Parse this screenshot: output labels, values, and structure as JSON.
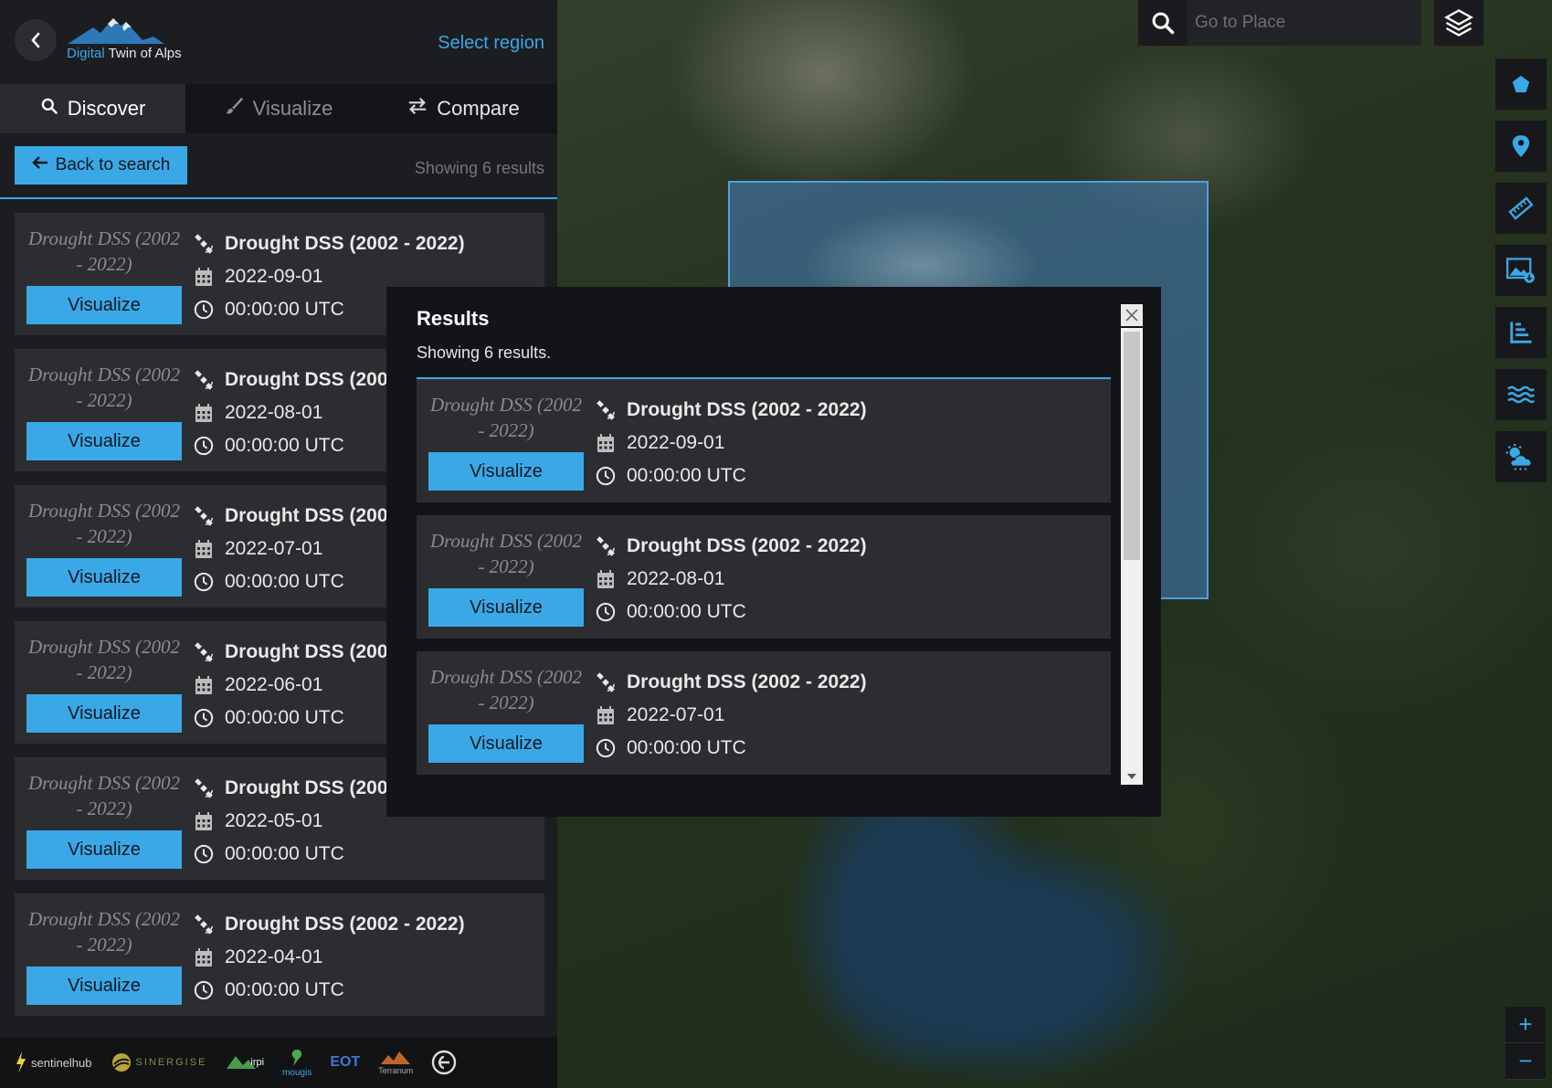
{
  "app": {
    "brand_accent": "Digital",
    "brand_rest": " Twin of Alps",
    "select_region": "Select region"
  },
  "tabs": [
    {
      "label": "Discover",
      "icon": "search-icon"
    },
    {
      "label": "Visualize",
      "icon": "brush-icon"
    },
    {
      "label": "Compare",
      "icon": "swap-icon"
    }
  ],
  "search": {
    "back_label": "Back to search",
    "showing": "Showing 6 results",
    "place_placeholder": "Go to Place"
  },
  "results": [
    {
      "thumb": "Drought DSS (2002 - 2022)",
      "name": "Drought DSS (2002 - 2022)",
      "date": "2022-09-01",
      "time": "00:00:00 UTC",
      "button": "Visualize"
    },
    {
      "thumb": "Drought DSS (2002 - 2022)",
      "name": "Drought DSS (200",
      "date": "2022-08-01",
      "time": "00:00:00 UTC",
      "button": "Visualize"
    },
    {
      "thumb": "Drought DSS (2002 - 2022)",
      "name": "Drought DSS (200",
      "date": "2022-07-01",
      "time": "00:00:00 UTC",
      "button": "Visualize"
    },
    {
      "thumb": "Drought DSS (2002 - 2022)",
      "name": "Drought DSS (200",
      "date": "2022-06-01",
      "time": "00:00:00 UTC",
      "button": "Visualize"
    },
    {
      "thumb": "Drought DSS (2002 - 2022)",
      "name": "Drought DSS (200",
      "date": "2022-05-01",
      "time": "00:00:00 UTC",
      "button": "Visualize"
    },
    {
      "thumb": "Drought DSS (2002 - 2022)",
      "name": "Drought DSS (2002 - 2022)",
      "date": "2022-04-01",
      "time": "00:00:00 UTC",
      "button": "Visualize"
    }
  ],
  "modal": {
    "title": "Results",
    "subtitle": "Showing 6 results.",
    "items": [
      {
        "thumb": "Drought DSS (2002 - 2022)",
        "name": "Drought DSS (2002 - 2022)",
        "date": "2022-09-01",
        "time": "00:00:00 UTC",
        "button": "Visualize"
      },
      {
        "thumb": "Drought DSS (2002 - 2022)",
        "name": "Drought DSS (2002 - 2022)",
        "date": "2022-08-01",
        "time": "00:00:00 UTC",
        "button": "Visualize"
      },
      {
        "thumb": "Drought DSS (2002 - 2022)",
        "name": "Drought DSS (2002 - 2022)",
        "date": "2022-07-01",
        "time": "00:00:00 UTC",
        "button": "Visualize"
      }
    ]
  },
  "toolbar": [
    "pentagon-icon",
    "map-pin-icon",
    "ruler-icon",
    "image-download-icon",
    "chart-icon",
    "water-icon",
    "weather-icon"
  ],
  "footer_logos": [
    "sentinelhub",
    "SINERGISE",
    "irpi",
    "mougis",
    "EOT",
    "Terranum"
  ],
  "colors": {
    "accent": "#3aa8e6",
    "panel": "#1c1d21",
    "card": "#2c2d31"
  }
}
